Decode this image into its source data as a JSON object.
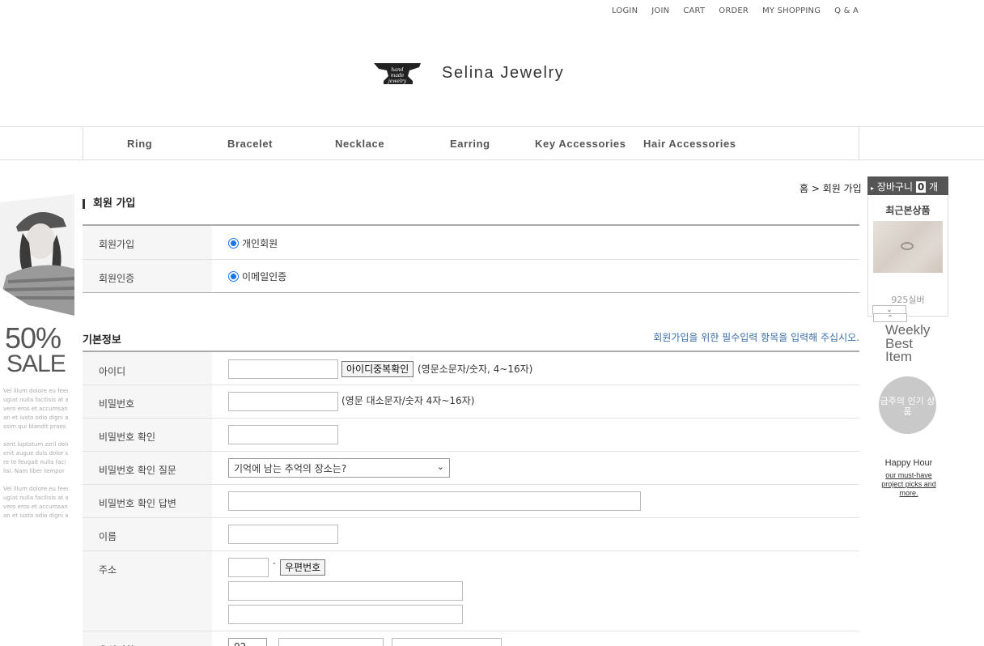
{
  "top_nav": [
    "LOGIN",
    "JOIN",
    "CART",
    "ORDER",
    "MY SHOPPING",
    "Q & A"
  ],
  "logo": {
    "text": "Selina Jewelry",
    "mark_text": "hand made jewelry"
  },
  "categories": [
    "Ring",
    "Bracelet",
    "Necklace",
    "Earring",
    "Key Accessories",
    "Hair Accessories"
  ],
  "left_banner": {
    "sale_percent": "50%",
    "sale_label": "SALE",
    "lorem_lines": [
      "Vel illum dolore eu feeu",
      "ugiat nulla facilisis at ac",
      "vero eros et accumsan",
      "an et iusto odio digni a",
      "ssim qui blandit praes",
      "",
      "sent luptatum zzril delen",
      "enit augue duis dolor s",
      "re te feugait nulla faci",
      "lisi. Nam liber tempor",
      "",
      "Vel illum dolore eu feeu",
      "ugiat nulla facilisis at ac",
      "vero eros et accumsan",
      "an et iusto odio digni a"
    ]
  },
  "breadcrumb": "홈 > 회원 가입",
  "page_title": "회원 가입",
  "membership": {
    "rows": [
      {
        "label": "회원가입",
        "option": "개인회원"
      },
      {
        "label": "회원인증",
        "option": "이메일인증"
      }
    ]
  },
  "basic_info": {
    "title": "기본정보",
    "note": "회원가입을 위한 필수입력 항목을 입력해 주십시오.",
    "id_label": "아이디",
    "id_check_button": "아이디중복확인",
    "id_hint": "(영문소문자/숫자, 4~16자)",
    "pw_label": "비밀번호",
    "pw_hint": "(영문 대소문자/숫자 4자~16자)",
    "pw_confirm_label": "비밀번호 확인",
    "pw_question_label": "비밀번호 확인 질문",
    "pw_question_value": "기억에 남는 추억의 장소는?",
    "pw_answer_label": "비밀번호 확인 답변",
    "name_label": "이름",
    "address_label": "주소",
    "zip_dash": "-",
    "zip_button": "우편번호",
    "phone_label": "유선전화",
    "phone_area": "02"
  },
  "right_sidebar": {
    "cart_label": "장바구니",
    "cart_count": "0",
    "cart_unit": "개",
    "recent_title": "최근본상품",
    "recent_item": "925실버",
    "weekly": "Weekly Best Item",
    "hot_label": "금주의 인기 상품",
    "happy_hour": "Happy Hour",
    "happy_sub": "our must-have project picks and more."
  }
}
